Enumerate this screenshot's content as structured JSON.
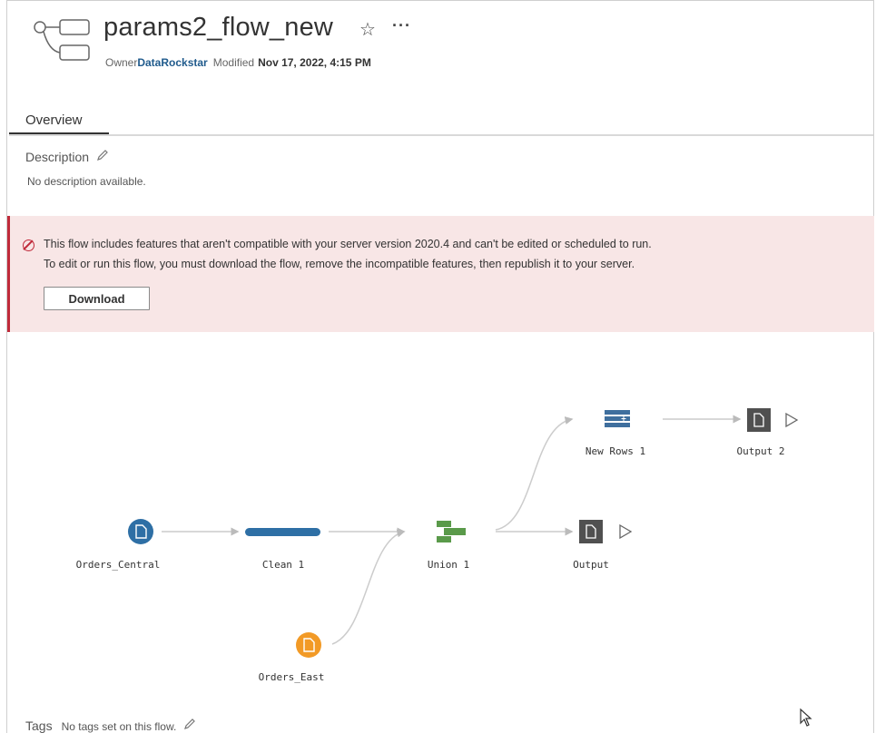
{
  "header": {
    "title": "params2_flow_new",
    "owner_label": "Owner",
    "owner_name": "DataRockstar",
    "modified_label": "Modified",
    "modified_date": "Nov 17, 2022, 4:15 PM",
    "favorite_icon": "star-icon",
    "more_icon": "more-icon"
  },
  "tabs": [
    {
      "label": "Overview",
      "active": true
    }
  ],
  "description": {
    "label": "Description",
    "text": "No description available."
  },
  "alert": {
    "line1": "This flow includes features that aren't compatible with your server version 2020.4 and can't be edited or scheduled to run.",
    "line2": "To edit or run this flow, you must download the flow, remove the incompatible features, then republish it to your server.",
    "button_label": "Download",
    "accent_color": "#c02a3a",
    "background_color": "#f8e6e6"
  },
  "flow": {
    "nodes": {
      "orders_central": "Orders_Central",
      "clean1": "Clean 1",
      "union1": "Union 1",
      "output": "Output",
      "new_rows1": "New Rows 1",
      "output2": "Output 2",
      "orders_east": "Orders_East"
    },
    "colors": {
      "input_central": "#2e6fa5",
      "input_east": "#f29a26",
      "clean": "#2e6fa5",
      "union": "#5a9a4a",
      "new_rows": "#3f6f9e",
      "output": "#505050"
    }
  },
  "tags": {
    "label": "Tags",
    "text": "No tags set on this flow."
  }
}
